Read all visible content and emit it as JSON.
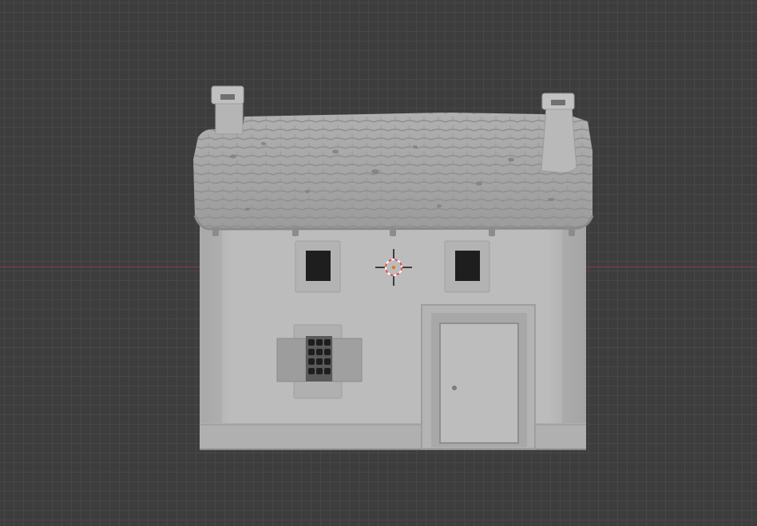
{
  "viewport": {
    "background_color": "#3d3d3d",
    "grid_minor_color": "#474747",
    "grid_major_color": "#4f4f4f",
    "x_axis_color": "#8a3a44"
  },
  "scene": {
    "model": "house",
    "model_color": "#b9b9b9",
    "roof_color": "#a9a9a9",
    "opening_color": "#1e1e1e",
    "cursor_ring_colors": [
      "#e04b4b",
      "#ffffff"
    ]
  }
}
